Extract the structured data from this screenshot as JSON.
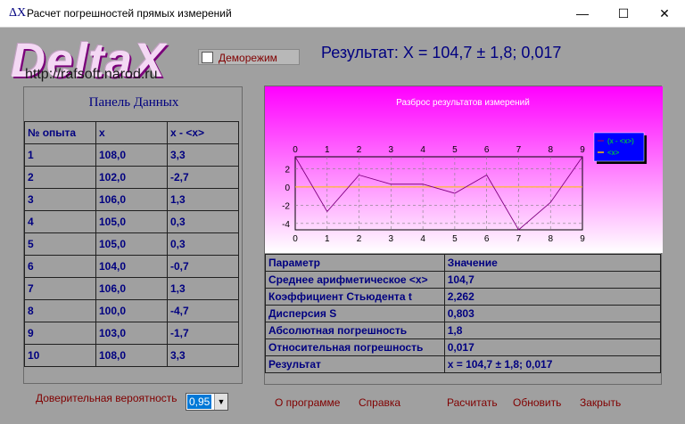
{
  "window": {
    "icon": "ΔX",
    "title": "Расчет погрешностей прямых измерений",
    "minimize": "—",
    "maximize": "☐",
    "close": "✕"
  },
  "logo": {
    "text": "DeltaX",
    "url": "http://rafsoft.narod.ru"
  },
  "demo": {
    "label": "Деморежим",
    "checked": false
  },
  "result_header": "Результат: X = 104,7 ± 1,8;  0,017",
  "data_panel": {
    "title": "Панель Данных",
    "headers": [
      "№ опыта",
      "x",
      "x - <x>"
    ],
    "rows": [
      [
        "1",
        "108,0",
        "3,3"
      ],
      [
        "2",
        "102,0",
        "-2,7"
      ],
      [
        "3",
        "106,0",
        "1,3"
      ],
      [
        "4",
        "105,0",
        "0,3"
      ],
      [
        "5",
        "105,0",
        "0,3"
      ],
      [
        "6",
        "104,0",
        "-0,7"
      ],
      [
        "7",
        "106,0",
        "1,3"
      ],
      [
        "8",
        "100,0",
        "-4,7"
      ],
      [
        "9",
        "103,0",
        "-1,7"
      ],
      [
        "10",
        "108,0",
        "3,3"
      ]
    ]
  },
  "chart_data": {
    "type": "line",
    "title": "Разброс результатов измерений",
    "x": [
      0,
      1,
      2,
      3,
      4,
      5,
      6,
      7,
      8,
      9
    ],
    "x_ticks": [
      "0",
      "1",
      "2",
      "3",
      "4",
      "5",
      "6",
      "7",
      "8",
      "9"
    ],
    "y_ticks": [
      "2",
      "0",
      "-2",
      "-4"
    ],
    "ylim": [
      -4.7,
      3.3
    ],
    "series": [
      {
        "name": "(x - <x>)",
        "color": "#800080",
        "values": [
          3.3,
          -2.7,
          1.3,
          0.3,
          0.3,
          -0.7,
          1.3,
          -4.7,
          -1.7,
          3.3
        ]
      },
      {
        "name": "<x>",
        "color": "#ffc000",
        "values": [
          0,
          0,
          0,
          0,
          0,
          0,
          0,
          0,
          0,
          0
        ]
      }
    ],
    "legend": "top-right",
    "grid": true,
    "colors": {
      "bg_top": "#ff00ff",
      "bg_bottom": "#ffffff",
      "legend_bg": "#0000ff",
      "legend_text": "#00ff00"
    }
  },
  "params_table": {
    "headers": [
      "Параметр",
      "Значение"
    ],
    "rows": [
      [
        "Среднее арифметическое  <x>",
        "104,7"
      ],
      [
        "Коэффициент Стьюдента  t",
        "2,262"
      ],
      [
        "Дисперсия  S",
        "0,803"
      ],
      [
        "Абсолютная погрешность",
        "1,8"
      ],
      [
        "Относительная погрешность",
        "0,017"
      ],
      [
        "Результат",
        "x = 104,7 ± 1,8;  0,017"
      ]
    ]
  },
  "confidence": {
    "label": "Доверительная вероятность",
    "value": "0,95"
  },
  "buttons": {
    "about": "О программе",
    "help": "Справка",
    "calculate": "Расчитать",
    "refresh": "Обновить",
    "close": "Закрыть"
  }
}
